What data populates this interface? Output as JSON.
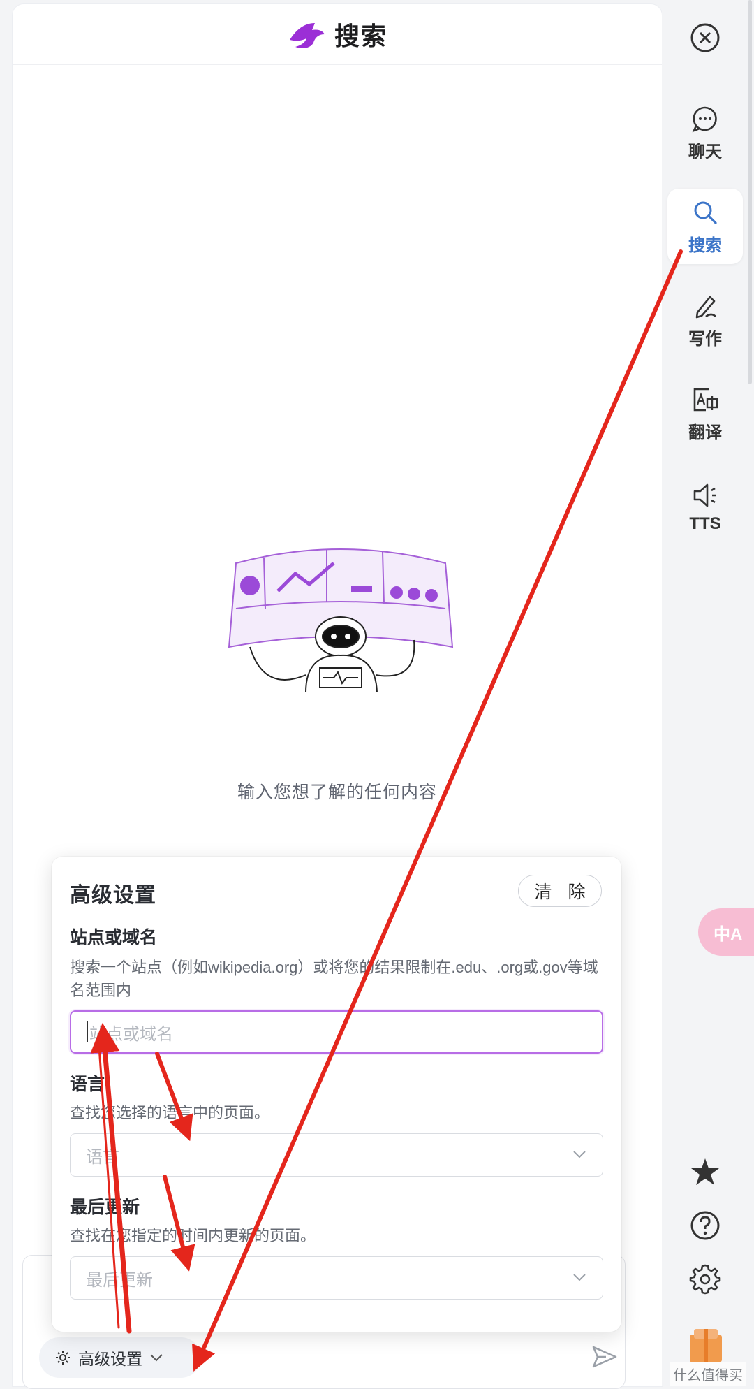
{
  "header": {
    "title": "搜索",
    "logo_icon": "bird-logo-icon",
    "brand_color": "#9b2fd6"
  },
  "main": {
    "empty_prompt": "输入您想了解的任何内容"
  },
  "advanced": {
    "title": "高级设置",
    "clear_label": "清 除",
    "site": {
      "title": "站点或域名",
      "desc": "搜索一个站点（例如wikipedia.org）或将您的结果限制在.edu、.org或.gov等域名范围内",
      "placeholder": "站点或域名"
    },
    "language": {
      "title": "语言",
      "desc": "查找您选择的语言中的页面。",
      "placeholder": "语言"
    },
    "updated": {
      "title": "最后更新",
      "desc": "查找在您指定的时间内更新的页面。",
      "placeholder": "最后更新"
    }
  },
  "composer": {
    "advanced_label": "高级设置",
    "send_icon": "send-icon"
  },
  "sidebar": {
    "close_icon": "close-circle-icon",
    "items": [
      {
        "label": "聊天",
        "icon": "chat-bubble-icon"
      },
      {
        "label": "搜索",
        "icon": "search-icon",
        "active": true
      },
      {
        "label": "写作",
        "icon": "pen-icon"
      },
      {
        "label": "翻译",
        "icon": "translate-image-icon"
      },
      {
        "label": "TTS",
        "icon": "speaker-icon"
      }
    ],
    "translate_float": "中A",
    "bottom_icons": [
      "star-icon",
      "help-icon",
      "settings-icon",
      "gift-icon"
    ],
    "active_color": "#3b74c8"
  },
  "watermark": "什么值得买"
}
